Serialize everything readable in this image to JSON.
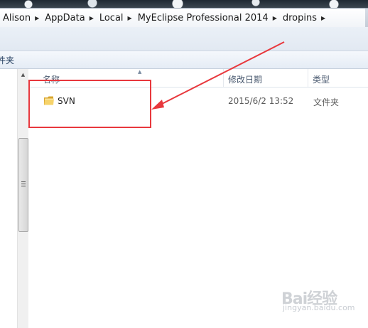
{
  "address_bar": {
    "crumbs": [
      "Alison",
      "AppData",
      "Local",
      "MyEclipse Professional 2014",
      "dropins"
    ]
  },
  "toolbar": {
    "partial_label": "件夹"
  },
  "columns": {
    "name": "名称",
    "date_modified": "修改日期",
    "type": "类型"
  },
  "files": [
    {
      "name": "SVN",
      "date": "2015/6/2 13:52",
      "type": "文件夹",
      "icon": "folder-icon"
    }
  ],
  "watermark": {
    "text": "Bai经验",
    "url": "jingyan.baidu.com"
  },
  "colors": {
    "annotation_red": "#e8383d",
    "folder_yellow": "#f2c94c"
  }
}
